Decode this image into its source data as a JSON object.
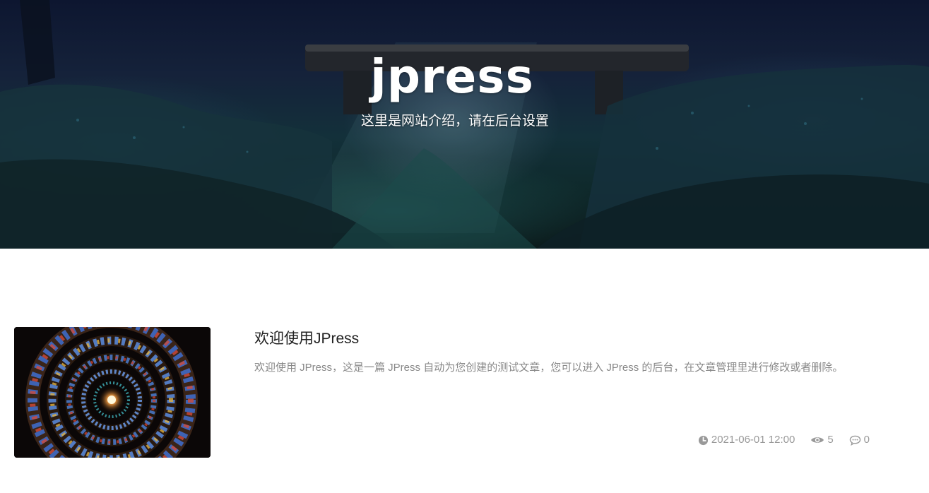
{
  "hero": {
    "title": "jpress",
    "subtitle": "这里是网站介绍，请在后台设置"
  },
  "post": {
    "title": "欢迎使用JPress",
    "excerpt": "欢迎使用 JPress，这是一篇 JPress 自动为您创建的测试文章，您可以进入 JPress 的后台，在文章管理里进行修改或者删除。",
    "date": "2021-06-01 12:00",
    "views": "5",
    "comments": "0",
    "thumbnail_icon": "spiral-stained-glass-image"
  },
  "icons": {
    "date": "clock-icon",
    "views": "eye-icon",
    "comments": "comment-icon"
  },
  "colors": {
    "meta_text": "#999999",
    "excerpt_text": "#888888",
    "title_text": "#222222"
  }
}
